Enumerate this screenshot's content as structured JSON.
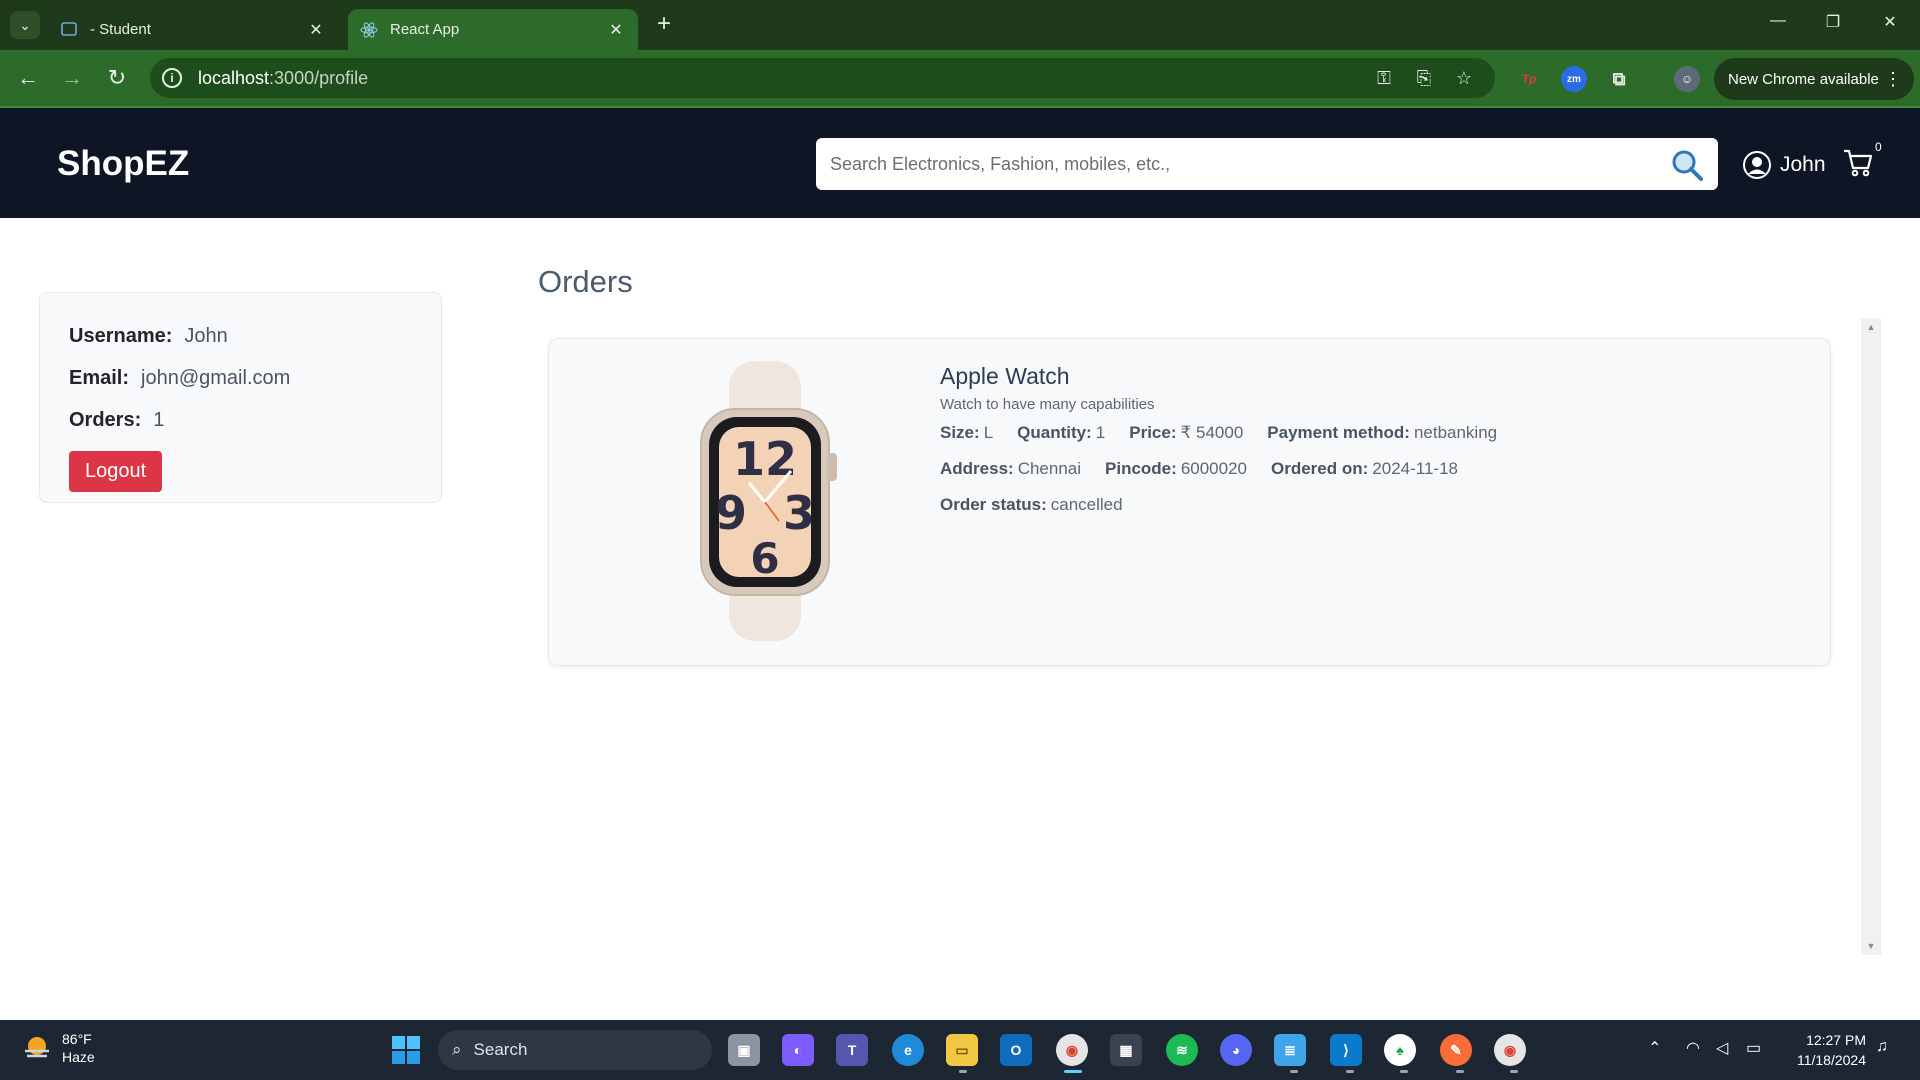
{
  "browser": {
    "tabs": [
      {
        "title": "- Student",
        "active": false
      },
      {
        "title": "React App",
        "active": true
      }
    ],
    "url_host": "localhost",
    "url_path": ":3000/profile",
    "update_label": "New Chrome available",
    "theme_color": "#2c6b2a"
  },
  "app": {
    "brand": "ShopEZ",
    "search_placeholder": "Search Electronics, Fashion, mobiles, etc.,",
    "user_name": "John",
    "cart_count": "0",
    "header_color": "#0e1626"
  },
  "profile": {
    "username_label": "Username:",
    "username": "John",
    "email_label": "Email:",
    "email": "john@gmail.com",
    "orders_label": "Orders:",
    "orders": "1",
    "logout_label": "Logout",
    "logout_color": "#dc3545"
  },
  "orders": {
    "title": "Orders",
    "items": [
      {
        "name": "Apple Watch",
        "description": "Watch to have many capabilities",
        "size_label": "Size:",
        "size": "L",
        "quantity_label": "Quantity:",
        "quantity": "1",
        "price_label": "Price:",
        "price": "₹ 54000",
        "payment_label": "Payment method:",
        "payment": "netbanking",
        "address_label": "Address:",
        "address": "Chennai",
        "pincode_label": "Pincode:",
        "pincode": "6000020",
        "ordered_label": "Ordered on:",
        "ordered_on": "2024-11-18",
        "status_label": "Order status:",
        "status": "cancelled"
      }
    ]
  },
  "taskbar": {
    "weather_temp": "86°F",
    "weather_desc": "Haze",
    "search_label": "Search",
    "time": "12:27 PM",
    "date": "11/18/2024"
  }
}
